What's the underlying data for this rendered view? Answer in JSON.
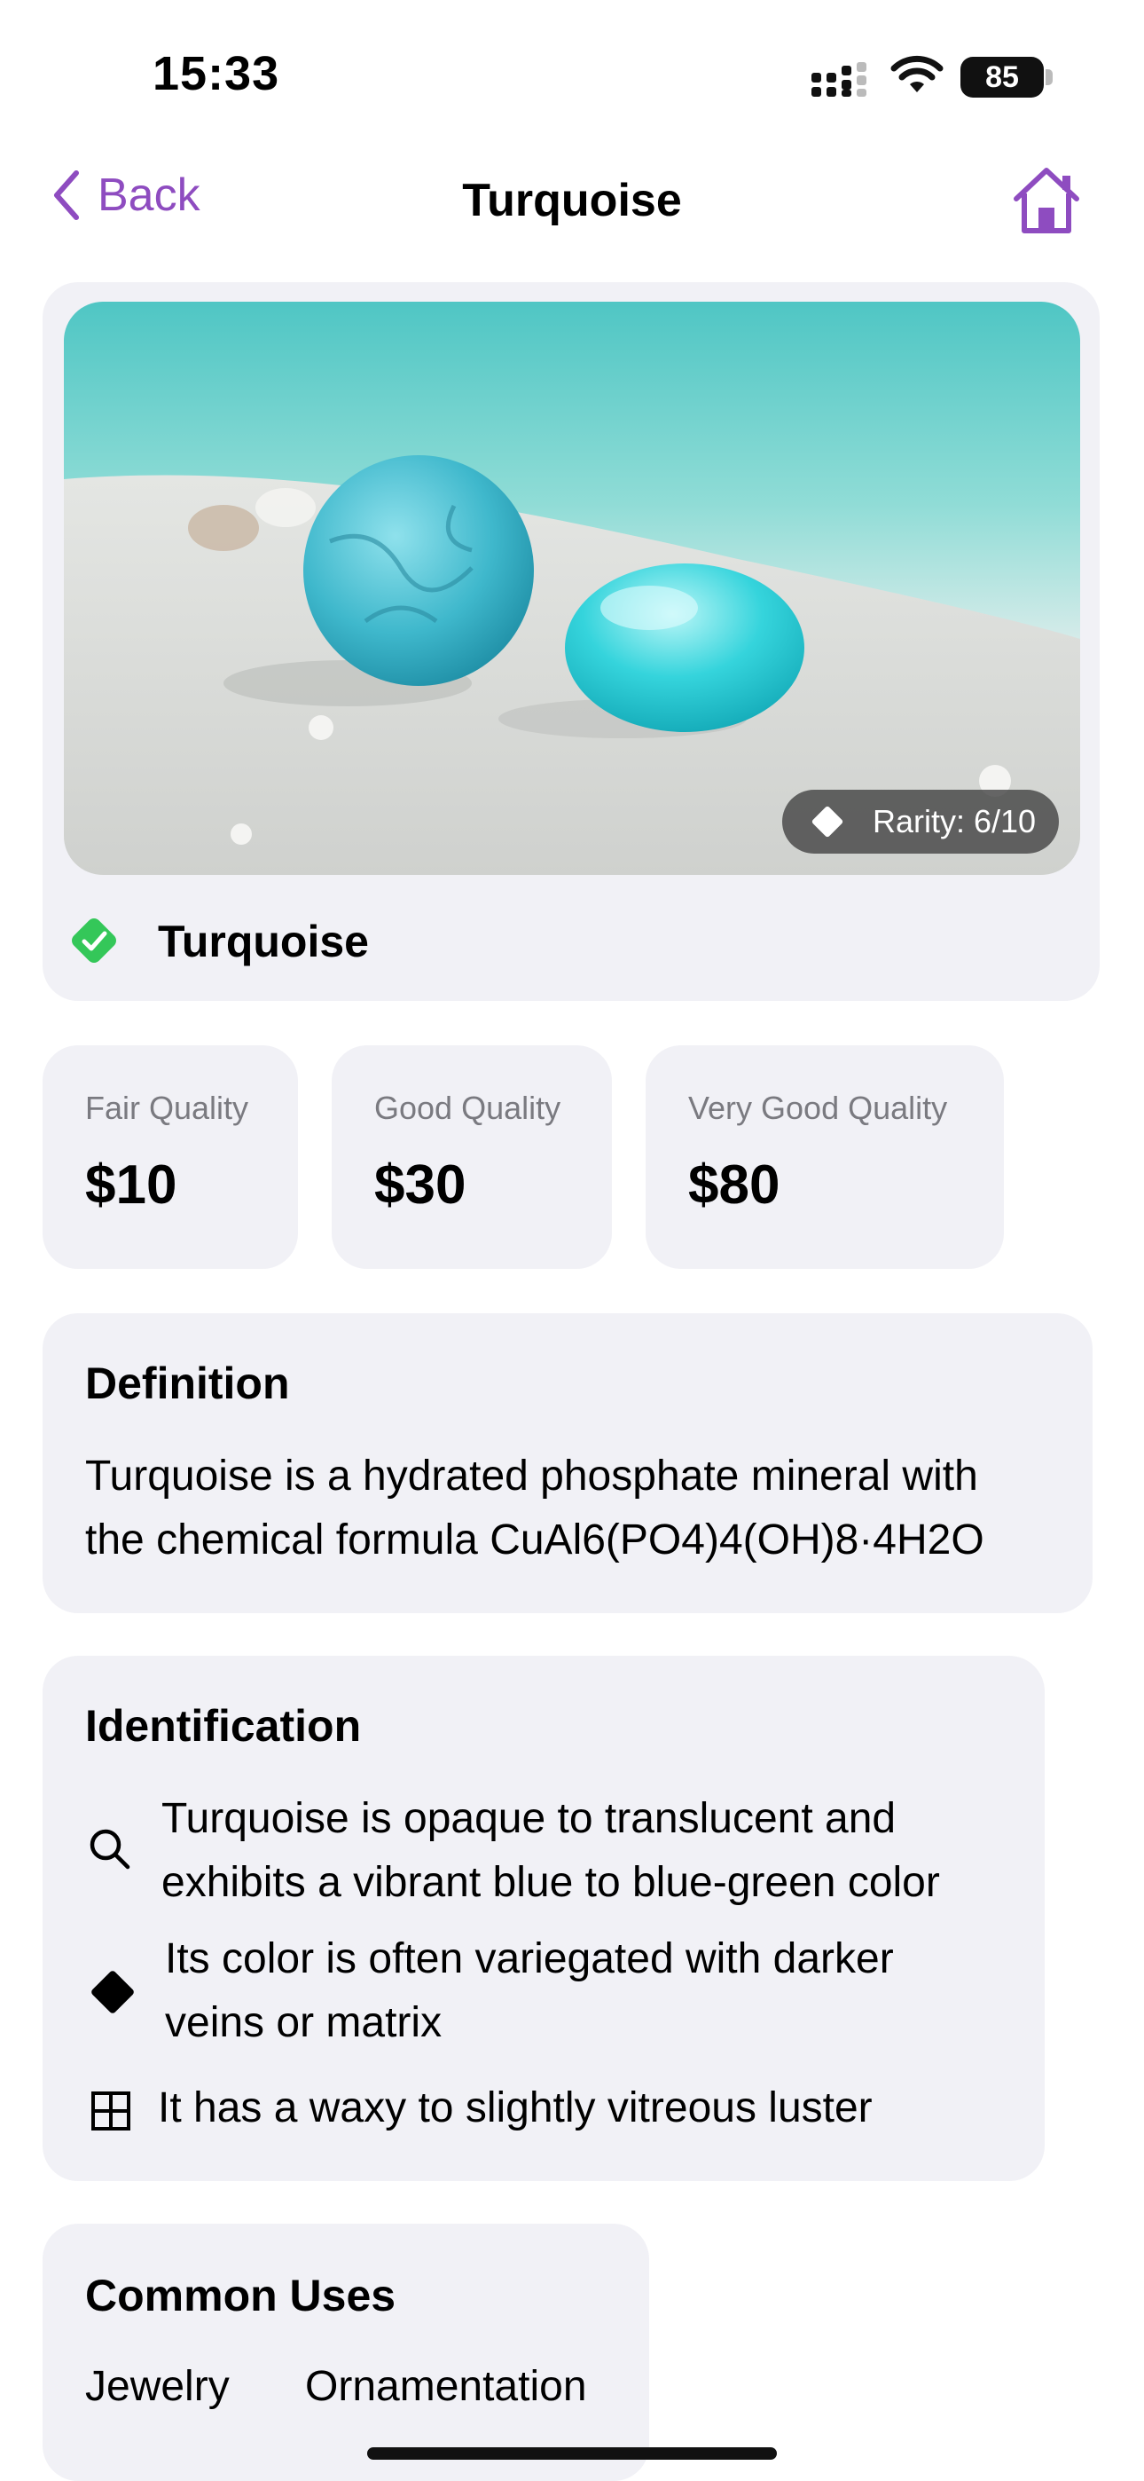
{
  "status_bar": {
    "time": "15:33",
    "battery": "85"
  },
  "nav": {
    "back_label": "Back",
    "title": "Turquoise"
  },
  "hero": {
    "rarity": "Rarity: 6/10",
    "name": "Turquoise"
  },
  "prices": [
    {
      "label": "Fair Quality",
      "value": "$10"
    },
    {
      "label": "Good Quality",
      "value": "$30"
    },
    {
      "label": "Very Good Quality",
      "value": "$80"
    }
  ],
  "definition": {
    "title": "Definition",
    "line1": "Turquoise is a hydrated phosphate mineral with",
    "line2": "the chemical formula CuAl6(PO4)4(OH)8·4H2O"
  },
  "identification": {
    "title": "Identification",
    "items": [
      {
        "icon": "magnifier-icon",
        "line1": "Turquoise is opaque to translucent and",
        "line2": "exhibits a vibrant blue to blue-green color"
      },
      {
        "icon": "diamond-icon",
        "line1": "Its color is often variegated with darker",
        "line2": "veins or matrix"
      },
      {
        "icon": "grid-icon",
        "line1": "It has a waxy to slightly vitreous luster"
      }
    ]
  },
  "uses": {
    "title": "Common Uses",
    "items": [
      "Jewelry",
      "Ornamentation"
    ]
  },
  "colors": {
    "accent": "#8e4cc0",
    "card": "#f1f1f6",
    "verified": "#34c759"
  }
}
